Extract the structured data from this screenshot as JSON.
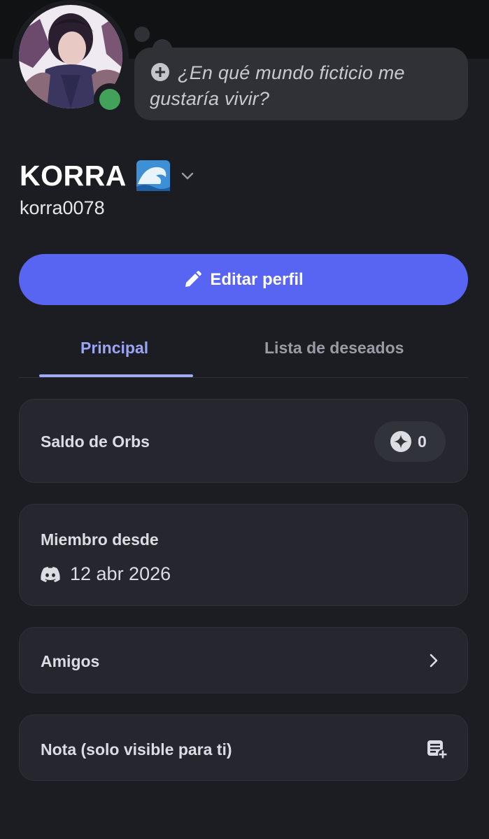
{
  "header": {
    "status_color": "#43a25a",
    "avatar_icon": "profile-avatar-image"
  },
  "custom_status": {
    "icon": "add-circle-icon",
    "placeholder": "¿En qué mundo ficticio me gustaría vivir?"
  },
  "profile": {
    "display_name": "KORRA",
    "emoji": "water-wave-emoji",
    "username": "korra0078"
  },
  "actions": {
    "edit_profile_label": "Editar perfil",
    "edit_icon": "pencil-icon",
    "accent": "#5865f2"
  },
  "tabs": [
    {
      "label": "Principal",
      "active": true
    },
    {
      "label": "Lista de deseados",
      "active": false
    }
  ],
  "orbs": {
    "label": "Saldo de Orbs",
    "balance": "0",
    "icon": "orb-icon"
  },
  "member_since": {
    "label": "Miembro desde",
    "date": "12 abr 2026",
    "icon": "discord-icon"
  },
  "friends": {
    "label": "Amigos",
    "icon": "chevron-right-icon"
  },
  "note": {
    "label": "Nota (solo visible para ti)",
    "icon": "add-note-icon"
  }
}
